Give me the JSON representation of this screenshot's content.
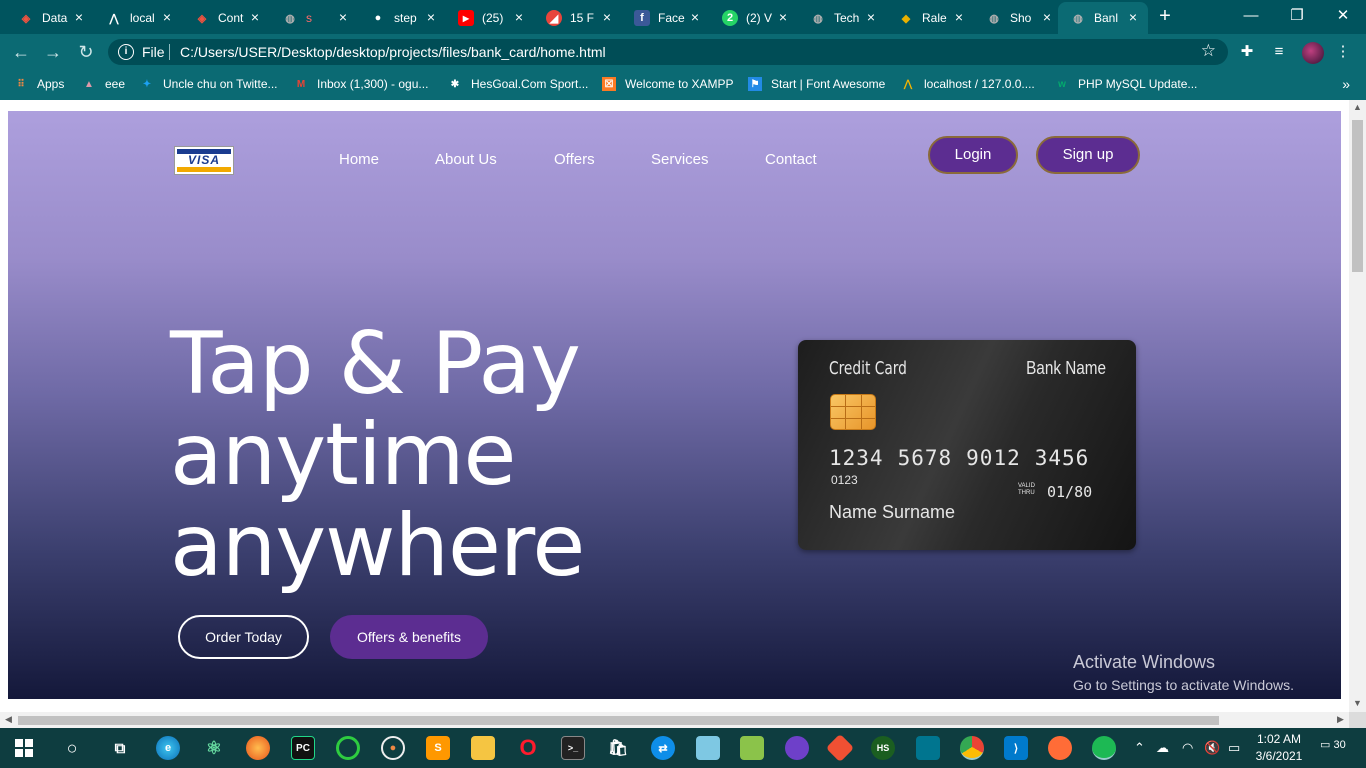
{
  "browser": {
    "tabs": [
      {
        "label": "Data",
        "icon": "laravel-icon",
        "color": "#f05340"
      },
      {
        "label": "local",
        "icon": "phpmyadmin-icon",
        "color": "#ffffff"
      },
      {
        "label": "Cont",
        "icon": "laravel-icon",
        "color": "#f05340"
      },
      {
        "label": "s",
        "icon": "globe-icon",
        "color": "#b0b0b0"
      },
      {
        "label": "step",
        "icon": "github-icon",
        "color": "#ffffff"
      },
      {
        "label": "(25)",
        "icon": "youtube-icon",
        "color": "#ff0000"
      },
      {
        "label": "15 F",
        "icon": "codepen-icon",
        "color": "#e8453c"
      },
      {
        "label": "Face",
        "icon": "facebook-icon",
        "color": "#3b5998"
      },
      {
        "label": "(2) V",
        "icon": "whatsapp-icon",
        "color": "#25d366"
      },
      {
        "label": "Tech",
        "icon": "globe-icon",
        "color": "#b0b0b0"
      },
      {
        "label": "Rale",
        "icon": "raleway-icon",
        "color": "#e8b100"
      },
      {
        "label": "Sho",
        "icon": "globe-icon",
        "color": "#b0b0b0"
      },
      {
        "label": "Banl",
        "icon": "globe-icon",
        "color": "#b0b0b0"
      }
    ],
    "active_tab": 12,
    "window_controls": {
      "minimize": "—",
      "restore": "❐",
      "close": "✕"
    },
    "address": {
      "scheme": "File",
      "url": "C:/Users/USER/Desktop/desktop/projects/files/bank_card/home.html"
    },
    "bookmarks": [
      {
        "label": "Apps",
        "icon": "apps-grid-icon"
      },
      {
        "label": "eee",
        "icon": "bookmark-icon"
      },
      {
        "label": "Uncle chu on Twitte...",
        "icon": "twitter-icon"
      },
      {
        "label": "Inbox (1,300) - ogu...",
        "icon": "gmail-icon"
      },
      {
        "label": "HesGoal.Com Sport...",
        "icon": "soccer-icon"
      },
      {
        "label": "Welcome to XAMPP",
        "icon": "xampp-icon"
      },
      {
        "label": "Start | Font Awesome",
        "icon": "flag-icon"
      },
      {
        "label": "localhost / 127.0.0....",
        "icon": "phpmyadmin-icon"
      },
      {
        "label": "PHP MySQL Update...",
        "icon": "w3schools-icon"
      }
    ],
    "more_bookmarks": "»"
  },
  "site": {
    "logo_text": "VISA",
    "nav": [
      "Home",
      "About Us",
      "Offers",
      "Services",
      "Contact"
    ],
    "login": "Login",
    "signup": "Sign up",
    "headline": [
      "Tap & Pay",
      "anytime",
      "anywhere"
    ],
    "order_btn": "Order Today",
    "offers_btn": "Offers & benefits",
    "card": {
      "title": "Credit Card",
      "bank": "Bank Name",
      "number": [
        "1234",
        "5678",
        "9012",
        "3456"
      ],
      "small": "0123",
      "valid_label": "VALID THRU",
      "valid": "01/80",
      "name": "Name Surname"
    },
    "accent": "#5c2d91"
  },
  "watermark": {
    "line1": "Activate Windows",
    "line2": "Go to Settings to activate Windows."
  },
  "taskbar": {
    "apps": [
      "windows-start-icon",
      "cortana-icon",
      "task-view-icon",
      "edge-icon",
      "atom-icon",
      "firefox-icon",
      "pycharm-icon",
      "circle-app-icon",
      "media-icon",
      "sublime-icon",
      "file-explorer-icon",
      "opera-icon",
      "terminal-icon",
      "store-icon",
      "teamviewer-icon",
      "notepad-icon",
      "chart-app-icon",
      "github-desktop-icon",
      "git-icon",
      "hs-icon",
      "mysql-workbench-icon",
      "chrome-icon",
      "vscode-icon",
      "postman-icon",
      "spotify-icon"
    ],
    "time": "1:02 AM",
    "date": "3/6/2021",
    "notifications": "30"
  }
}
